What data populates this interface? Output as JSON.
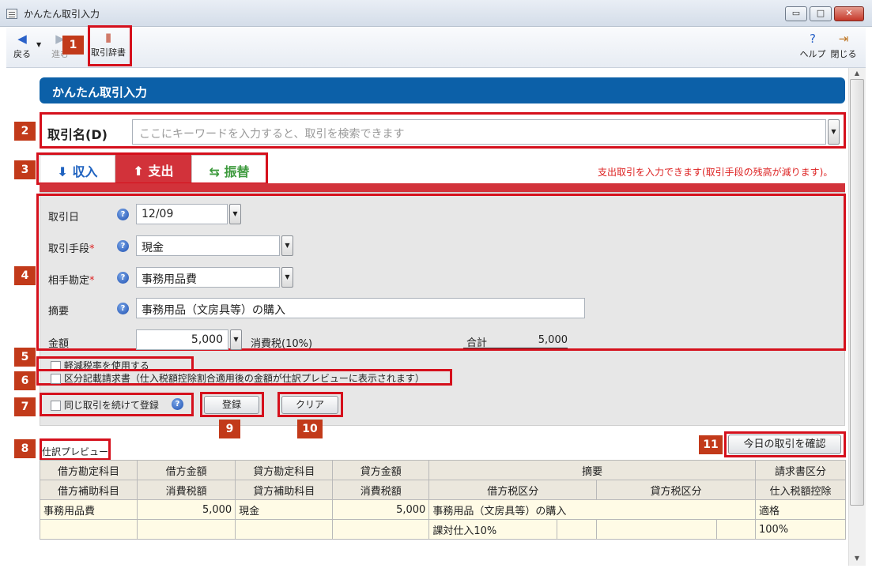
{
  "window": {
    "title": "かんたん取引入力",
    "min": "▭",
    "max": "□",
    "close": "✕"
  },
  "toolbar": {
    "back": "戻る",
    "forward": "進む",
    "dictionary": "取引辞書",
    "help": "ヘルプ",
    "close": "閉じる"
  },
  "header": {
    "title": "かんたん取引入力"
  },
  "callouts": [
    "1",
    "2",
    "3",
    "4",
    "5",
    "6",
    "7",
    "8",
    "9",
    "10",
    "11"
  ],
  "search": {
    "label": "取引名(D)",
    "placeholder": "ここにキーワードを入力すると、取引を検索できます"
  },
  "tabs": [
    {
      "label": "収入",
      "icon": "income-icon"
    },
    {
      "label": "支出",
      "icon": "expense-icon"
    },
    {
      "label": "振替",
      "icon": "transfer-icon"
    }
  ],
  "tab_hint": "支出取引を入力できます(取引手段の残高が減ります)。",
  "form": {
    "date_label": "取引日",
    "date_value": "12/09",
    "method_label": "取引手段",
    "method_value": "現金",
    "account_label": "相手勘定",
    "account_value": "事務用品費",
    "memo_label": "摘要",
    "memo_value": "事務用品（文房具等）の購入",
    "amount_label": "金額",
    "amount_value": "5,000",
    "tax_label": "消費税(10%)",
    "total_label": "合計",
    "total_value": "5,000",
    "required_mark": "*",
    "help_mark": "?"
  },
  "options": {
    "reduced_rate": "軽減税率を使用する",
    "invoice": "区分記載請求書（仕入税額控除割合適用後の金額が仕訳プレビューに表示されます）",
    "continue": "同じ取引を続けて登録"
  },
  "buttons": {
    "register": "登録",
    "clear": "クリア",
    "today": "今日の取引を確認"
  },
  "preview": {
    "title": "仕訳プレビュー",
    "header1": [
      "借方勘定科目",
      "借方金額",
      "貸方勘定科目",
      "貸方金額",
      "摘要",
      "請求書区分"
    ],
    "header2": [
      "借方補助科目",
      "消費税額",
      "貸方補助科目",
      "消費税額",
      "借方税区分",
      "貸方税区分",
      "仕入税額控除"
    ],
    "row1": {
      "debit_account": "事務用品費",
      "debit_amount": "5,000",
      "credit_account": "現金",
      "credit_amount": "5,000",
      "memo": "事務用品（文房具等）の購入",
      "invoice": "適格"
    },
    "row2": {
      "debit_tax": "課対仕入10%",
      "deduction": "100%"
    }
  },
  "colors": {
    "accent": "#0c60a8",
    "expense_tab": "#d2323a",
    "callout": "#c23a1a",
    "highlight": "#d5101c"
  }
}
